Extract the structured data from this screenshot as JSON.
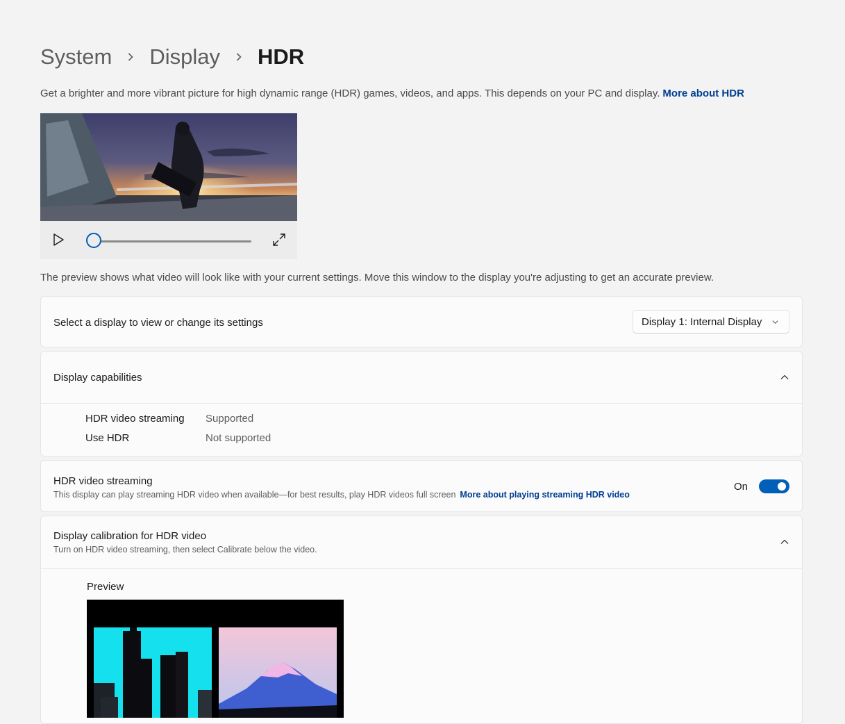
{
  "breadcrumb": {
    "items": [
      "System",
      "Display"
    ],
    "current": "HDR"
  },
  "intro": {
    "text": "Get a brighter and more vibrant picture for high dynamic range (HDR) games, videos, and apps. This depends on your PC and display.",
    "link": "More about HDR"
  },
  "player": {
    "play_icon": "play-icon",
    "fullscreen_icon": "expand-icon",
    "progress": 0
  },
  "note": "The preview shows what video will look like with your current settings. Move this window to the display you're adjusting to get an accurate preview.",
  "display_select": {
    "label": "Select a display to view or change its settings",
    "value": "Display 1: Internal Display"
  },
  "capabilities": {
    "title": "Display capabilities",
    "rows": [
      {
        "name": "HDR video streaming",
        "value": "Supported"
      },
      {
        "name": "Use HDR",
        "value": "Not supported"
      }
    ]
  },
  "streaming": {
    "title": "HDR video streaming",
    "description": "This display can play streaming HDR video when available—for best results, play HDR videos full screen",
    "link": "More about playing streaming HDR video",
    "state_label": "On",
    "enabled": true
  },
  "calibration": {
    "title": "Display calibration for HDR video",
    "description": "Turn on HDR video streaming, then select Calibrate below the video.",
    "preview_label": "Preview"
  },
  "colors": {
    "accent": "#005fb8",
    "link": "#003e92",
    "background": "#f3f3f3",
    "card": "#fbfbfb"
  }
}
